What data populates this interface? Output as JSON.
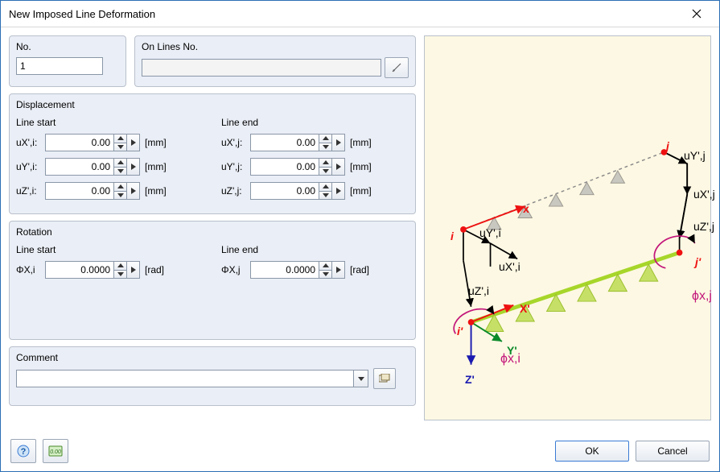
{
  "window": {
    "title": "New Imposed Line Deformation"
  },
  "top": {
    "no_label": "No.",
    "no_value": "1",
    "onlines_label": "On Lines No.",
    "onlines_value": ""
  },
  "disp": {
    "legend": "Displacement",
    "start_head": "Line start",
    "end_head": "Line end",
    "unit": "[mm]",
    "rows_i": [
      {
        "label": "uX',i:",
        "value": "0.00"
      },
      {
        "label": "uY',i:",
        "value": "0.00"
      },
      {
        "label": "uZ',i:",
        "value": "0.00"
      }
    ],
    "rows_j": [
      {
        "label": "uX',j:",
        "value": "0.00"
      },
      {
        "label": "uY',j:",
        "value": "0.00"
      },
      {
        "label": "uZ',j:",
        "value": "0.00"
      }
    ]
  },
  "rot": {
    "legend": "Rotation",
    "start_head": "Line start",
    "end_head": "Line end",
    "unit": "[rad]",
    "i": {
      "label": "ΦX,i",
      "value": "0.0000"
    },
    "j": {
      "label": "ΦX,j",
      "value": "0.0000"
    }
  },
  "comment": {
    "legend": "Comment",
    "value": ""
  },
  "footer": {
    "ok": "OK",
    "cancel": "Cancel"
  },
  "diagram": {
    "j": "j",
    "i": "i",
    "ip": "i'",
    "jp": "j'",
    "Xp": "X'",
    "Yp": "Y'",
    "Zp": "Z'",
    "x": "x",
    "uYj": "uY',j",
    "uXj": "uX',j",
    "uZj": "uZ',j",
    "uYi": "uY',i",
    "uXi": "uX',i",
    "uZi": "uZ',i",
    "phixi": "ϕx,i",
    "phixj": "ϕx,j"
  }
}
